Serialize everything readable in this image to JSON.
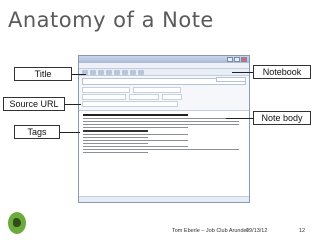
{
  "slide": {
    "title": "Anatomy of a Note"
  },
  "callouts": {
    "title": "Title",
    "source_url": "Source URL",
    "tags": "Tags",
    "notebook": "Notebook",
    "note_body": "Note body"
  },
  "footer": {
    "author": "Tom Eberle – Job Club Arundel",
    "date": "09/13/12",
    "page": "12"
  },
  "logo": {
    "icon": "evernote-elephant-icon",
    "color": "#6cab3b"
  }
}
